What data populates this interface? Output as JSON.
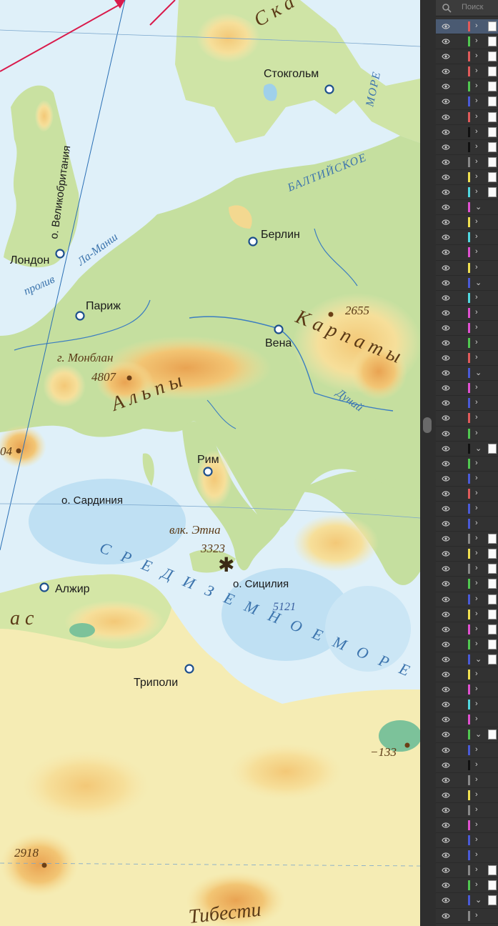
{
  "map": {
    "cities": {
      "stockholm": "Стокгольм",
      "london": "Лондон",
      "berlin": "Берлин",
      "paris": "Париж",
      "vienna": "Вена",
      "rome": "Рим",
      "algiers": "Алжир",
      "tripoli": "Триполи"
    },
    "islands": {
      "great_britain": "о. Великобритания",
      "sardinia": "о. Сардиния",
      "sicily": "о. Сицилия"
    },
    "mountains": {
      "alps": "А л ь п ы",
      "carpathians": "К а р п а т ы",
      "scandinavian": "С к а",
      "atlas": "а с",
      "tibesti": "Тибести"
    },
    "peaks": {
      "mont_blanc": "г. Монблан",
      "mont_blanc_height": "4807",
      "carpathian_height": "2655",
      "etna": "влк. Этна",
      "etna_height": "3323",
      "west_height": "04",
      "sahara_height": "2918",
      "depression_depth": "−133"
    },
    "water": {
      "baltic_sea_1": "БАЛТИЙСКОЕ",
      "baltic_sea_2": "МОРЕ",
      "channel_1": "пролив",
      "channel_2": "Ла-Манш",
      "danube": "Дунай",
      "mediterranean": "С Р Е Д И З Е М Н О Е   М О Р Е",
      "med_depth": "5121"
    }
  },
  "panel": {
    "search_placeholder": "Поиск",
    "layers": [
      {
        "color": "#e05a5a",
        "chevron": "›",
        "thumb": true,
        "selected": true
      },
      {
        "color": "#50c850",
        "chevron": "›",
        "thumb": true
      },
      {
        "color": "#e05a5a",
        "chevron": "›",
        "thumb": true
      },
      {
        "color": "#e05a5a",
        "chevron": "›",
        "thumb": true
      },
      {
        "color": "#50c850",
        "chevron": "›",
        "thumb": true
      },
      {
        "color": "#4a5ad8",
        "chevron": "›",
        "thumb": true
      },
      {
        "color": "#e05a5a",
        "chevron": "›",
        "thumb": true
      },
      {
        "color": "#111111",
        "chevron": "›",
        "thumb": true
      },
      {
        "color": "#111111",
        "chevron": "›",
        "thumb": true
      },
      {
        "color": "#888888",
        "chevron": "›",
        "thumb": true
      },
      {
        "color": "#f0e050",
        "chevron": "›",
        "thumb": true
      },
      {
        "color": "#50d8e0",
        "chevron": "›",
        "thumb": true
      },
      {
        "color": "#e050d0",
        "chevron": "⌄",
        "thumb": false
      },
      {
        "color": "#f0e050",
        "chevron": "›",
        "thumb": false
      },
      {
        "color": "#50d8e0",
        "chevron": "›",
        "thumb": false
      },
      {
        "color": "#e050d0",
        "chevron": "›",
        "thumb": false
      },
      {
        "color": "#f0e050",
        "chevron": "›",
        "thumb": false
      },
      {
        "color": "#4a5ad8",
        "chevron": "⌄",
        "thumb": false
      },
      {
        "color": "#50d8e0",
        "chevron": "›",
        "thumb": false
      },
      {
        "color": "#e050d0",
        "chevron": "›",
        "thumb": false
      },
      {
        "color": "#e050d0",
        "chevron": "›",
        "thumb": false
      },
      {
        "color": "#50c850",
        "chevron": "›",
        "thumb": false
      },
      {
        "color": "#e05a5a",
        "chevron": "›",
        "thumb": false
      },
      {
        "color": "#4a5ad8",
        "chevron": "⌄",
        "thumb": false
      },
      {
        "color": "#e050d0",
        "chevron": "›",
        "thumb": false
      },
      {
        "color": "#4a5ad8",
        "chevron": "›",
        "thumb": false
      },
      {
        "color": "#e05a5a",
        "chevron": "›",
        "thumb": false
      },
      {
        "color": "#50c850",
        "chevron": "›",
        "thumb": false
      },
      {
        "color": "#111111",
        "chevron": "⌄",
        "thumb": true
      },
      {
        "color": "#50c850",
        "chevron": "›",
        "thumb": false
      },
      {
        "color": "#4a5ad8",
        "chevron": "›",
        "thumb": false
      },
      {
        "color": "#e05a5a",
        "chevron": "›",
        "thumb": false
      },
      {
        "color": "#4a5ad8",
        "chevron": "›",
        "thumb": false
      },
      {
        "color": "#4a5ad8",
        "chevron": "›",
        "thumb": false
      },
      {
        "color": "#888888",
        "chevron": "›",
        "thumb": true
      },
      {
        "color": "#f0e050",
        "chevron": "›",
        "thumb": true
      },
      {
        "color": "#888888",
        "chevron": "›",
        "thumb": true
      },
      {
        "color": "#50c850",
        "chevron": "›",
        "thumb": true
      },
      {
        "color": "#4a5ad8",
        "chevron": "›",
        "thumb": true
      },
      {
        "color": "#f0e050",
        "chevron": "›",
        "thumb": true
      },
      {
        "color": "#e050d0",
        "chevron": "›",
        "thumb": true
      },
      {
        "color": "#50c850",
        "chevron": "›",
        "thumb": true
      },
      {
        "color": "#4a5ad8",
        "chevron": "⌄",
        "thumb": true
      },
      {
        "color": "#f0e050",
        "chevron": "›",
        "thumb": false
      },
      {
        "color": "#e050d0",
        "chevron": "›",
        "thumb": false
      },
      {
        "color": "#50d8e0",
        "chevron": "›",
        "thumb": false
      },
      {
        "color": "#e050d0",
        "chevron": "›",
        "thumb": false
      },
      {
        "color": "#50c850",
        "chevron": "⌄",
        "thumb": true
      },
      {
        "color": "#4a5ad8",
        "chevron": "›",
        "thumb": false
      },
      {
        "color": "#111111",
        "chevron": "›",
        "thumb": false
      },
      {
        "color": "#888888",
        "chevron": "›",
        "thumb": false
      },
      {
        "color": "#f0e050",
        "chevron": "›",
        "thumb": false
      },
      {
        "color": "#888888",
        "chevron": "›",
        "thumb": false
      },
      {
        "color": "#e050d0",
        "chevron": "›",
        "thumb": false
      },
      {
        "color": "#4a5ad8",
        "chevron": "›",
        "thumb": false
      },
      {
        "color": "#4a5ad8",
        "chevron": "›",
        "thumb": false
      },
      {
        "color": "#888888",
        "chevron": "›",
        "thumb": true
      },
      {
        "color": "#50c850",
        "chevron": "›",
        "thumb": true
      },
      {
        "color": "#4a5ad8",
        "chevron": "⌄",
        "thumb": true
      },
      {
        "color": "#888888",
        "chevron": "›",
        "thumb": false
      },
      {
        "color": "#f0e050",
        "chevron": "›",
        "thumb": false
      }
    ]
  }
}
